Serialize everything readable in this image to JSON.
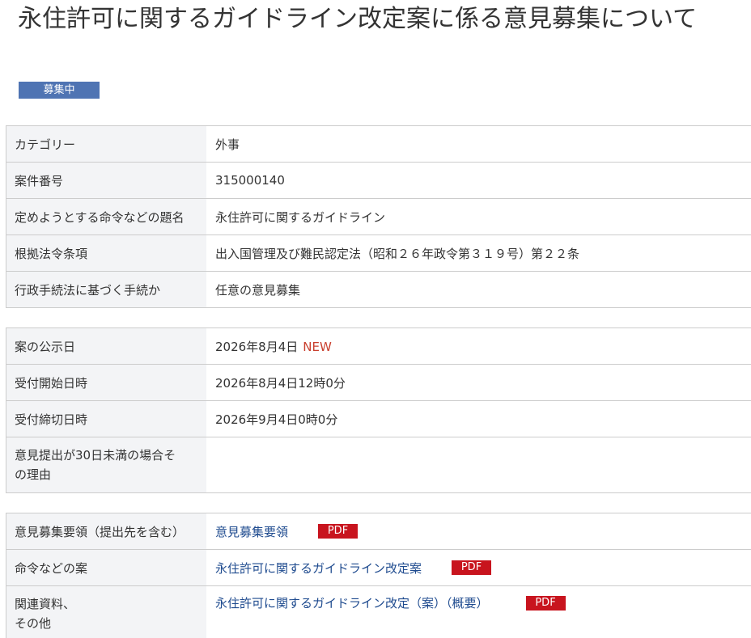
{
  "page": {
    "title": "永住許可に関するガイドライン改定案に係る意見募集について",
    "status": "募集中"
  },
  "basic_info": {
    "category_label": "カテゴリー",
    "category_value": "外事",
    "case_number_label": "案件番号",
    "case_number_value": "315000140",
    "subject_label": "定めようとする命令などの題名",
    "subject_value": "永住許可に関するガイドライン",
    "legal_basis_label": "根拠法令条項",
    "legal_basis_value": "出入国管理及び難民認定法（昭和２６年政令第３１９号）第２２条",
    "procedure_label": "行政手続法に基づく手続か",
    "procedure_value": "任意の意見募集"
  },
  "schedule": {
    "published_label": "案の公示日",
    "published_value": "2026年8月4日",
    "new_mark": "NEW",
    "start_label": "受付開始日時",
    "start_value": "2026年8月4日12時0分",
    "deadline_label": "受付締切日時",
    "deadline_value": "2026年9月4日0時0分",
    "short_reason_label_line1": "意見提出が30日未満の場合そ",
    "short_reason_label_line2": "の理由",
    "short_reason_value": ""
  },
  "documents": {
    "guidelines_label": "意見募集要領（提出先を含む）",
    "guidelines_link": "意見募集要領",
    "draft_label": "命令などの案",
    "draft_link": "永住許可に関するガイドライン改定案",
    "related_label_line1": "関連資料、",
    "related_label_line2": "その他",
    "related_link": "永住許可に関するガイドライン改定（案）（概要）",
    "pdf_label": "PDF"
  },
  "colors": {
    "status_badge": "#4f74b3",
    "pdf_badge": "#c8141e",
    "new_mark": "#c9402f",
    "link": "#1f4b8f",
    "label_cell_bg": "#f3f4f6"
  }
}
